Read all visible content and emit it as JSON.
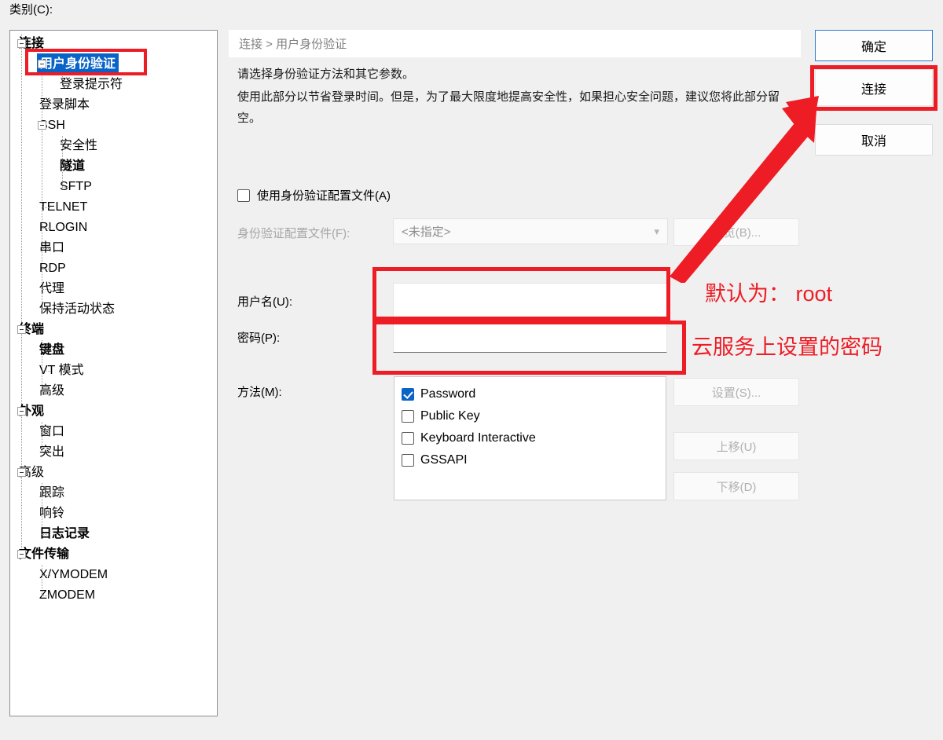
{
  "category_label": "类别(C):",
  "tree": {
    "items": [
      {
        "label": "连接",
        "level": 0,
        "bold": true,
        "expander": true,
        "selected": false
      },
      {
        "label": "用户身份验证",
        "level": 1,
        "bold": true,
        "expander": true,
        "selected": true
      },
      {
        "label": "登录提示符",
        "level": 2,
        "bold": false,
        "expander": false,
        "selected": false
      },
      {
        "label": "登录脚本",
        "level": 1,
        "bold": false,
        "expander": false,
        "selected": false
      },
      {
        "label": "SSH",
        "level": 1,
        "bold": false,
        "expander": true,
        "selected": false
      },
      {
        "label": "安全性",
        "level": 2,
        "bold": false,
        "expander": false,
        "selected": false
      },
      {
        "label": "隧道",
        "level": 2,
        "bold": true,
        "expander": false,
        "selected": false
      },
      {
        "label": "SFTP",
        "level": 2,
        "bold": false,
        "expander": false,
        "selected": false
      },
      {
        "label": "TELNET",
        "level": 1,
        "bold": false,
        "expander": false,
        "selected": false
      },
      {
        "label": "RLOGIN",
        "level": 1,
        "bold": false,
        "expander": false,
        "selected": false
      },
      {
        "label": "串口",
        "level": 1,
        "bold": false,
        "expander": false,
        "selected": false
      },
      {
        "label": "RDP",
        "level": 1,
        "bold": false,
        "expander": false,
        "selected": false
      },
      {
        "label": "代理",
        "level": 1,
        "bold": false,
        "expander": false,
        "selected": false
      },
      {
        "label": "保持活动状态",
        "level": 1,
        "bold": false,
        "expander": false,
        "selected": false
      },
      {
        "label": "终端",
        "level": 0,
        "bold": true,
        "expander": true,
        "selected": false
      },
      {
        "label": "键盘",
        "level": 1,
        "bold": true,
        "expander": false,
        "selected": false
      },
      {
        "label": "VT 模式",
        "level": 1,
        "bold": false,
        "expander": false,
        "selected": false
      },
      {
        "label": "高级",
        "level": 1,
        "bold": false,
        "expander": false,
        "selected": false
      },
      {
        "label": "外观",
        "level": 0,
        "bold": true,
        "expander": true,
        "selected": false
      },
      {
        "label": "窗口",
        "level": 1,
        "bold": false,
        "expander": false,
        "selected": false
      },
      {
        "label": "突出",
        "level": 1,
        "bold": false,
        "expander": false,
        "selected": false
      },
      {
        "label": "高级",
        "level": 0,
        "bold": false,
        "expander": true,
        "selected": false
      },
      {
        "label": "跟踪",
        "level": 1,
        "bold": false,
        "expander": false,
        "selected": false
      },
      {
        "label": "响铃",
        "level": 1,
        "bold": false,
        "expander": false,
        "selected": false
      },
      {
        "label": "日志记录",
        "level": 1,
        "bold": true,
        "expander": false,
        "selected": false
      },
      {
        "label": "文件传输",
        "level": 0,
        "bold": true,
        "expander": true,
        "selected": false
      },
      {
        "label": "X/YMODEM",
        "level": 1,
        "bold": false,
        "expander": false,
        "selected": false
      },
      {
        "label": "ZMODEM",
        "level": 1,
        "bold": false,
        "expander": false,
        "selected": false
      }
    ]
  },
  "breadcrumb": "连接 > 用户身份验证",
  "description": {
    "line1": "请选择身份验证方法和其它参数。",
    "line2": "使用此部分以节省登录时间。但是，为了最大限度地提高安全性，如果担心安全问题，建议您将此部分留空。"
  },
  "profile": {
    "checkbox_label": "使用身份验证配置文件(A)",
    "checkbox_checked": false,
    "field_label": "身份验证配置文件(F):",
    "selected_value": "<未指定>",
    "browse_label": "浏览(B)..."
  },
  "credentials": {
    "username_label": "用户名(U):",
    "username_value": "",
    "password_label": "密码(P):",
    "password_value": ""
  },
  "method": {
    "label": "方法(M):",
    "items": [
      {
        "label": "Password",
        "checked": true
      },
      {
        "label": "Public Key",
        "checked": false
      },
      {
        "label": "Keyboard Interactive",
        "checked": false
      },
      {
        "label": "GSSAPI",
        "checked": false
      }
    ],
    "settings_label": "设置(S)...",
    "move_up_label": "上移(U)",
    "move_down_label": "下移(D)"
  },
  "actions": {
    "ok_label": "确定",
    "connect_label": "连接",
    "cancel_label": "取消"
  },
  "annotations": {
    "username_note": "默认为：  root",
    "password_note": "云服务上设置的密码",
    "accent_color": "#ee1c25",
    "selection_color": "#0a64c8"
  }
}
